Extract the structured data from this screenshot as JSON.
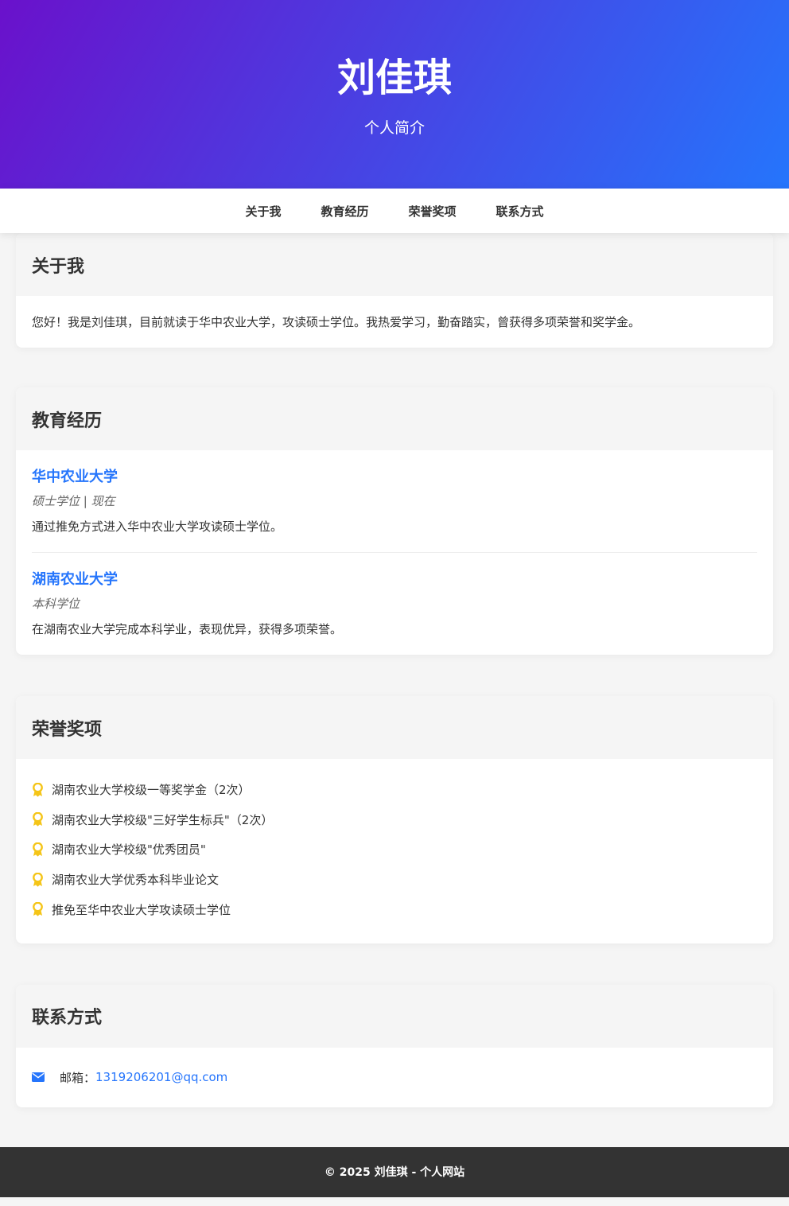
{
  "header": {
    "name": "刘佳琪",
    "subtitle": "个人简介"
  },
  "nav": {
    "items": [
      {
        "label": "关于我"
      },
      {
        "label": "教育经历"
      },
      {
        "label": "荣誉奖项"
      },
      {
        "label": "联系方式"
      }
    ]
  },
  "about": {
    "title": "关于我",
    "text": "您好！我是刘佳琪，目前就读于华中农业大学，攻读硕士学位。我热爱学习，勤奋踏实，曾获得多项荣誉和奖学金。"
  },
  "education": {
    "title": "教育经历",
    "items": [
      {
        "school": "华中农业大学",
        "meta": "硕士学位 | 现在",
        "desc": "通过推免方式进入华中农业大学攻读硕士学位。"
      },
      {
        "school": "湖南农业大学",
        "meta": "本科学位",
        "desc": "在湖南农业大学完成本科学业，表现优异，获得多项荣誉。"
      }
    ]
  },
  "honors": {
    "title": "荣誉奖项",
    "icon": "award-icon",
    "items": [
      "湖南农业大学校级一等奖学金（2次）",
      "湖南农业大学校级\"三好学生标兵\"（2次）",
      "湖南农业大学校级\"优秀团员\"",
      "湖南农业大学优秀本科毕业论文",
      "推免至华中农业大学攻读硕士学位"
    ]
  },
  "contact": {
    "title": "联系方式",
    "icon": "envelope-icon",
    "email_label": "邮箱：",
    "email": "1319206201@qq.com"
  },
  "footer": {
    "text": "© 2025 刘佳琪 - 个人网站"
  },
  "colors": {
    "gradient_start": "#6a11cb",
    "gradient_end": "#2575fc",
    "accent": "#2575fc",
    "award": "#f5c518",
    "footer_bg": "#333333"
  }
}
